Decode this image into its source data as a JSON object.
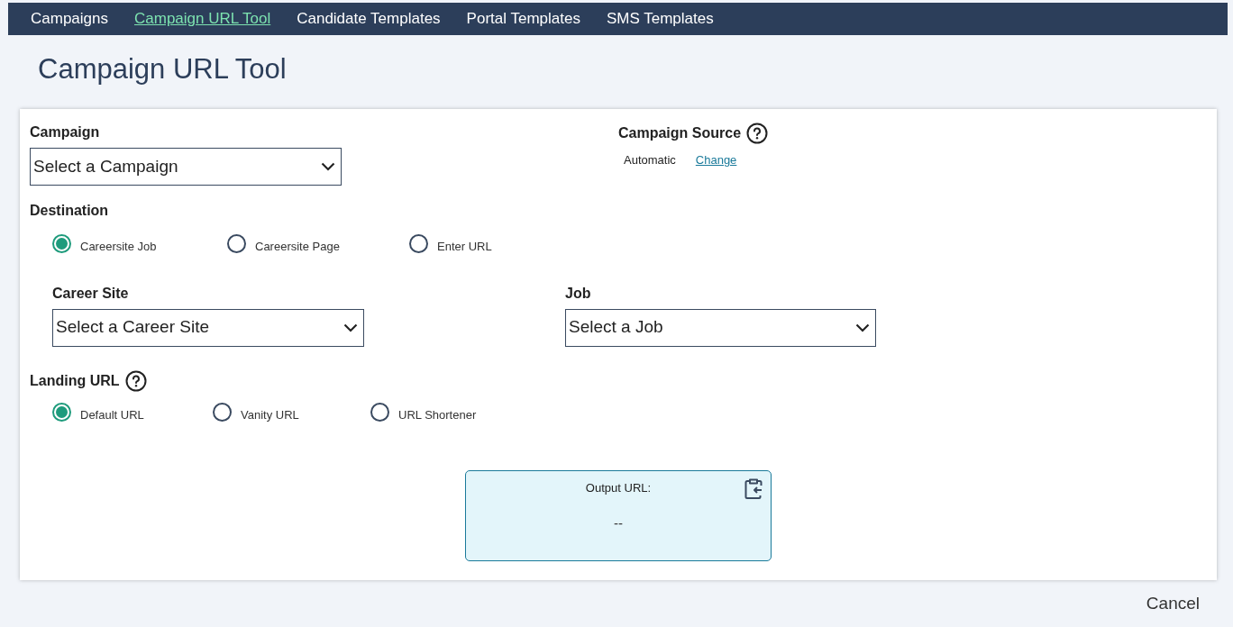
{
  "nav": [
    {
      "label": "Campaigns",
      "selected": false
    },
    {
      "label": "Campaign URL Tool",
      "selected": true
    },
    {
      "label": "Candidate Templates",
      "selected": false
    },
    {
      "label": "Portal Templates",
      "selected": false
    },
    {
      "label": "SMS Templates",
      "selected": false
    }
  ],
  "page_title": "Campaign URL Tool",
  "campaign": {
    "label": "Campaign",
    "value": "Select a Campaign"
  },
  "campaign_source": {
    "label": "Campaign Source",
    "value": "Automatic",
    "link": "Change"
  },
  "destination": {
    "label": "Destination",
    "options": [
      {
        "label": "Careersite Job",
        "selected": true
      },
      {
        "label": "Careersite Page",
        "selected": false
      },
      {
        "label": "Enter URL",
        "selected": false
      }
    ]
  },
  "career_site": {
    "label": "Career Site",
    "value": "Select a Career Site"
  },
  "job": {
    "label": "Job",
    "value": "Select a Job"
  },
  "landing_url": {
    "label": "Landing URL",
    "options": [
      {
        "label": "Default URL",
        "selected": true
      },
      {
        "label": "Vanity URL",
        "selected": false
      },
      {
        "label": "URL Shortener",
        "selected": false
      }
    ]
  },
  "output": {
    "label": "Output URL:",
    "value": "--"
  },
  "cancel": "Cancel"
}
